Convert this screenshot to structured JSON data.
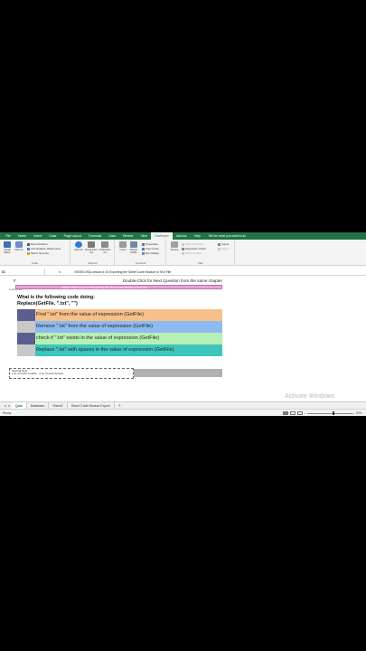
{
  "ribbon_tabs": [
    "File",
    "Home",
    "Insert",
    "Draw",
    "Page Layout",
    "Formulas",
    "Data",
    "Review",
    "View",
    "Developer",
    "Add-ins",
    "Help",
    "Tell me what you want to do"
  ],
  "active_tab_index": 9,
  "ribbon": {
    "code": {
      "visual_basic": "Visual Basic",
      "macros": "Macros",
      "record_macro": "Record Macro",
      "use_relative": "Use Relative References",
      "macro_security": "Macro Security",
      "label": "Code"
    },
    "addins": {
      "addins": "Add-ins",
      "excel_addins": "Excel Add-ins",
      "com_addins": "COM Add-ins",
      "label": "Add-ins"
    },
    "controls": {
      "insert": "Insert",
      "design_mode": "Design Mode",
      "properties": "Properties",
      "view_code": "View Code",
      "run_dialog": "Run Dialog",
      "label": "Controls"
    },
    "xml": {
      "source": "Source",
      "map_properties": "Map Properties",
      "expansion_packs": "Expansion Packs",
      "refresh_data": "Refresh Data",
      "import": "Import",
      "export": "Export",
      "label": "XML"
    }
  },
  "formula_bar": {
    "name_box": "B2",
    "fx": "fx",
    "formula": "VSEE5-VBA Lesson # 15 Exporting the Sheet Code Module to Text File"
  },
  "sheet": {
    "side_label": "1 out of 10",
    "header_left": "F",
    "header_title": "Double-Click for Next Question from the same chapter",
    "pink_bar_text": "VSEE5-VBA Lesson # 15 Exporting the Sheet Code Module to Text File",
    "question_line1": "What is the following code doing:",
    "question_line2": "Replace(GetFile, \".txt\", \"\")",
    "answers": [
      {
        "text": "Find \".txt\" from the value of expression (GetFile)",
        "swatch": "#5a5f8f",
        "bg": "#f7c08a"
      },
      {
        "text": "Remove \".txt\" from the value of expression (GetFile)",
        "swatch": "#c8c8c8",
        "bg": "#8dbaf0"
      },
      {
        "text": "check if \".txt\" exists in the value of expression (GetFile)",
        "swatch": "#5a5f8f",
        "bg": "#b7f0b4"
      },
      {
        "text": "Replace \".txt\" with spaces in the value of expression (GetFile)",
        "swatch": "#c8c8c8",
        "bg": "#3dc6bc"
      }
    ],
    "note_line1": "Scoring Note:",
    "note_line2": "(+1) on each module, -1 on Correct Answer",
    "watermark_title": "Activate Windows",
    "watermark_sub": "Go to Settings to activate Windows."
  },
  "sheet_tabs": [
    "Quiz",
    "Database",
    "Sheet2",
    "Sheet Code Module Export"
  ],
  "active_sheet_index": 0,
  "add_sheet": "+",
  "status": {
    "ready": "Ready",
    "zoom": "50%"
  }
}
